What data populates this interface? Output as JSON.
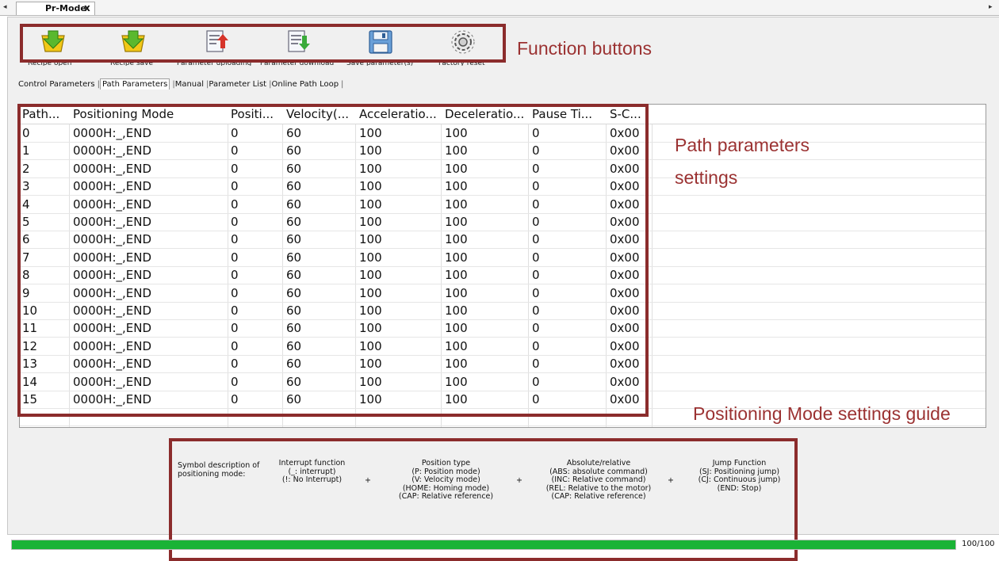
{
  "tab": {
    "title": "Pr-Mode",
    "close": "x",
    "left_arrow": "◂",
    "right_arrow": "▸"
  },
  "toolbar": [
    {
      "label": "Recipe open",
      "icon": "recipe-open-icon"
    },
    {
      "label": "Recipe save",
      "icon": "recipe-save-icon"
    },
    {
      "label": "Parameter uploading",
      "icon": "parameter-upload-icon"
    },
    {
      "label": "Parameter download",
      "icon": "parameter-download-icon"
    },
    {
      "label": "Save parameter(s)",
      "icon": "save-icon"
    },
    {
      "label": "Factory reset",
      "icon": "gear-icon"
    }
  ],
  "subtabs": [
    "Control Parameters",
    "Path Parameters",
    "Manual",
    "Parameter List",
    "Online Path Loop"
  ],
  "active_subtab": "Path Parameters",
  "table": {
    "columns": [
      "Path...",
      "Positioning Mode",
      "Positi...",
      "Velocity(...",
      "Acceleratio...",
      "Deceleratio...",
      "Pause Ti...",
      "S-C..."
    ],
    "rows": [
      [
        "0",
        "0000H:_,END",
        "0",
        "60",
        "100",
        "100",
        "0",
        "0x00"
      ],
      [
        "1",
        "0000H:_,END",
        "0",
        "60",
        "100",
        "100",
        "0",
        "0x00"
      ],
      [
        "2",
        "0000H:_,END",
        "0",
        "60",
        "100",
        "100",
        "0",
        "0x00"
      ],
      [
        "3",
        "0000H:_,END",
        "0",
        "60",
        "100",
        "100",
        "0",
        "0x00"
      ],
      [
        "4",
        "0000H:_,END",
        "0",
        "60",
        "100",
        "100",
        "0",
        "0x00"
      ],
      [
        "5",
        "0000H:_,END",
        "0",
        "60",
        "100",
        "100",
        "0",
        "0x00"
      ],
      [
        "6",
        "0000H:_,END",
        "0",
        "60",
        "100",
        "100",
        "0",
        "0x00"
      ],
      [
        "7",
        "0000H:_,END",
        "0",
        "60",
        "100",
        "100",
        "0",
        "0x00"
      ],
      [
        "8",
        "0000H:_,END",
        "0",
        "60",
        "100",
        "100",
        "0",
        "0x00"
      ],
      [
        "9",
        "0000H:_,END",
        "0",
        "60",
        "100",
        "100",
        "0",
        "0x00"
      ],
      [
        "10",
        "0000H:_,END",
        "0",
        "60",
        "100",
        "100",
        "0",
        "0x00"
      ],
      [
        "11",
        "0000H:_,END",
        "0",
        "60",
        "100",
        "100",
        "0",
        "0x00"
      ],
      [
        "12",
        "0000H:_,END",
        "0",
        "60",
        "100",
        "100",
        "0",
        "0x00"
      ],
      [
        "13",
        "0000H:_,END",
        "0",
        "60",
        "100",
        "100",
        "0",
        "0x00"
      ],
      [
        "14",
        "0000H:_,END",
        "0",
        "60",
        "100",
        "100",
        "0",
        "0x00"
      ],
      [
        "15",
        "0000H:_,END",
        "0",
        "60",
        "100",
        "100",
        "0",
        "0x00"
      ]
    ]
  },
  "annotations": {
    "function_buttons": "Function buttons",
    "path_params_line1": "Path parameters",
    "path_params_line2": "settings",
    "guide": "Positioning Mode settings guide"
  },
  "guide": {
    "intro": [
      "Symbol description of",
      "positioning mode:"
    ],
    "interrupt": [
      "Interrupt function",
      "(_: interrupt)",
      "(!: No Interrupt)"
    ],
    "position_type": [
      "Position type",
      "(P: Position mode)",
      "(V: Velocity mode)",
      "(HOME: Homing mode)",
      "(CAP: Relative reference)"
    ],
    "absolute_relative": [
      "Absolute/relative",
      "(ABS: absolute command)",
      "(INC: Relative command)",
      "(REL: Relative to the motor)",
      "(CAP: Relative reference)"
    ],
    "jump": [
      "Jump Function",
      "(SJ: Positioning jump)",
      "(CJ: Continuous jump)",
      "(END: Stop)"
    ],
    "plus": "+"
  },
  "progress": {
    "value": 1.0,
    "text": "100/100"
  },
  "colors": {
    "annotation": "#8b2c2c",
    "progress": "#1ab336"
  }
}
